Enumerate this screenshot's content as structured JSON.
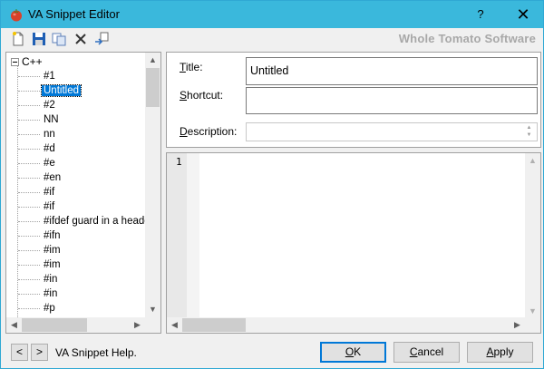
{
  "window": {
    "title": "VA Snippet Editor",
    "help_glyph": "?",
    "close_glyph": "✕"
  },
  "toolbar": {
    "buttons": [
      "new-snippet-icon",
      "save-icon",
      "copy-icon",
      "delete-icon",
      "import-icon"
    ],
    "brand": "Whole Tomato Software"
  },
  "tree": {
    "root": "C++",
    "items": [
      {
        "label": "#1"
      },
      {
        "label": "Untitled",
        "selected": true
      },
      {
        "label": "#2"
      },
      {
        "label": "NN"
      },
      {
        "label": "nn"
      },
      {
        "label": "#d"
      },
      {
        "label": "#e"
      },
      {
        "label": "#en"
      },
      {
        "label": "#if"
      },
      {
        "label": "#if"
      },
      {
        "label": "#ifdef guard in a heade"
      },
      {
        "label": "#ifn"
      },
      {
        "label": "#im"
      },
      {
        "label": "#im"
      },
      {
        "label": "#in"
      },
      {
        "label": "#in"
      },
      {
        "label": "#p"
      }
    ]
  },
  "form": {
    "title_label_key": "T",
    "title_label_rest": "itle:",
    "title_value": "Untitled",
    "shortcut_label_key": "S",
    "shortcut_label_rest": "hortcut:",
    "shortcut_value": "",
    "description_label_key": "D",
    "description_label_rest": "escription:",
    "description_value": ""
  },
  "editor": {
    "line_numbers": [
      "1"
    ],
    "content": ""
  },
  "footer": {
    "prev": "<",
    "next": ">",
    "help_text": "VA Snippet Help.",
    "ok_key": "O",
    "ok_rest": "K",
    "cancel_key": "C",
    "cancel_rest": "ancel",
    "apply_key": "A",
    "apply_rest": "pply"
  },
  "colors": {
    "titlebar": "#3ab8dc",
    "selection": "#0078d7",
    "brand_text": "#a8a8a8"
  }
}
